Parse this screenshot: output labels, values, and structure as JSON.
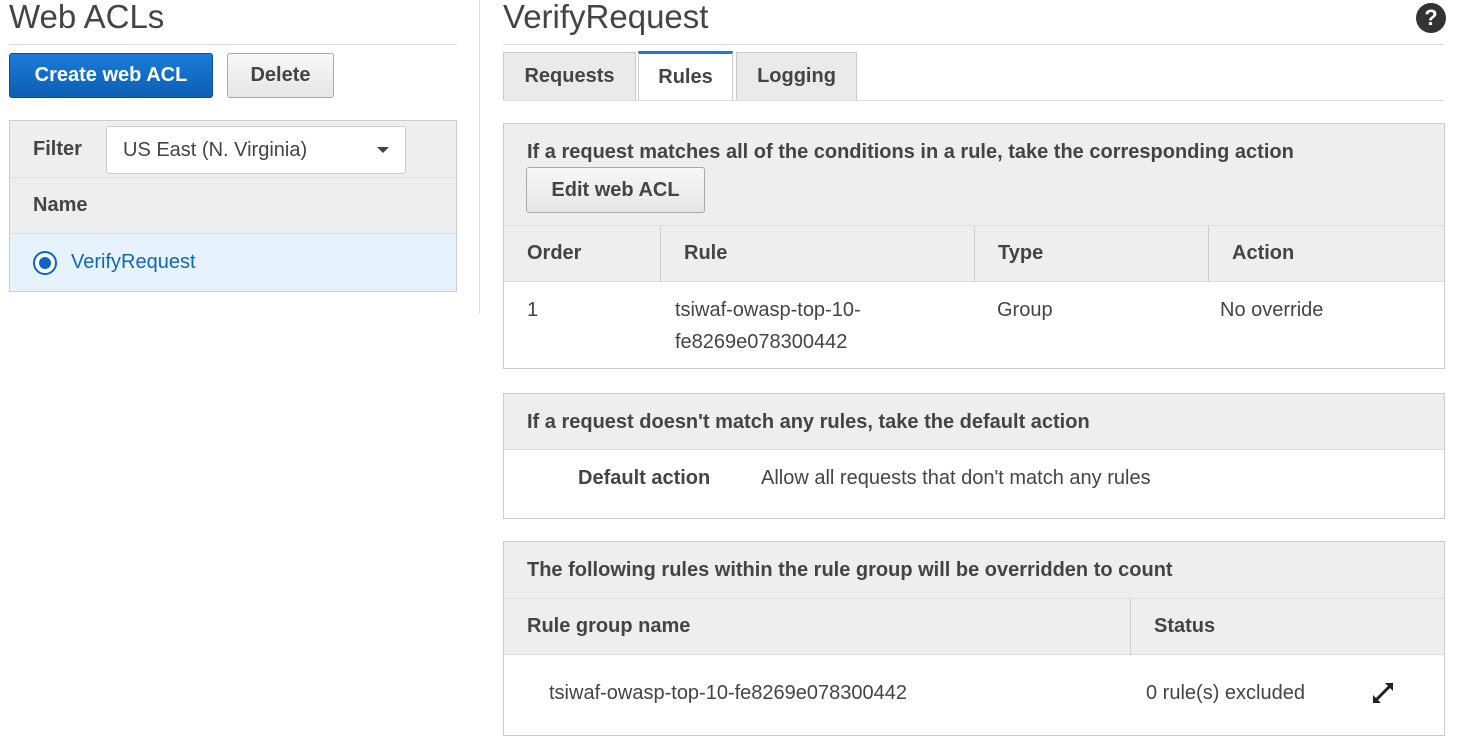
{
  "left": {
    "title": "Web ACLs",
    "create_button": "Create web ACL",
    "delete_button": "Delete",
    "filter_label": "Filter",
    "filter_value": "US East (N. Virginia)",
    "name_header": "Name",
    "acls": [
      {
        "name": "VerifyRequest",
        "selected": true
      }
    ]
  },
  "right": {
    "title": "VerifyRequest",
    "help_icon": "?",
    "tabs": [
      {
        "label": "Requests",
        "active": false
      },
      {
        "label": "Rules",
        "active": true
      },
      {
        "label": "Logging",
        "active": false
      }
    ],
    "rules_panel": {
      "heading": "If a request matches all of the conditions in a rule, take the corresponding action",
      "edit_button": "Edit web ACL",
      "columns": [
        "Order",
        "Rule",
        "Type",
        "Action"
      ],
      "rows": [
        {
          "order": "1",
          "rule_line1": "tsiwaf-owasp-top-10-",
          "rule_line2": "fe8269e078300442",
          "type": "Group",
          "action": "No override"
        }
      ]
    },
    "default_panel": {
      "heading": "If a request doesn't match any rules, take the default action",
      "label": "Default action",
      "value": "Allow all requests that don't match any rules"
    },
    "override_panel": {
      "heading": "The following rules within the rule group will be overridden to count",
      "columns": [
        "Rule group name",
        "Status"
      ],
      "rows": [
        {
          "group": "tsiwaf-owasp-top-10-fe8269e078300442",
          "status": "0 rule(s) excluded"
        }
      ]
    }
  }
}
